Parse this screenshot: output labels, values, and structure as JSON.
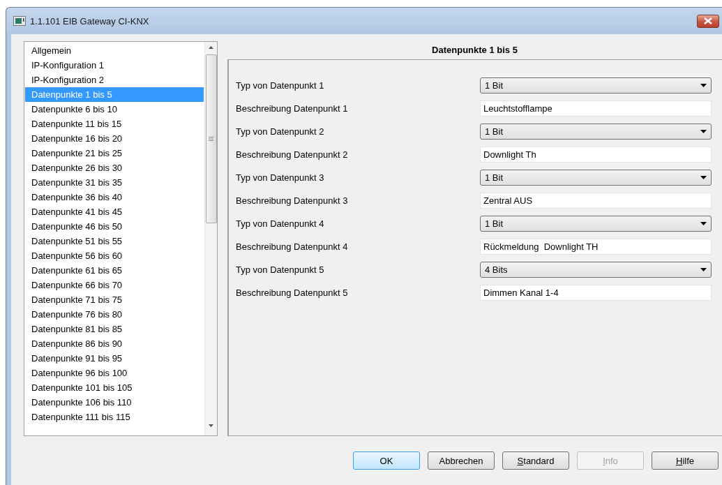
{
  "window": {
    "title": "1.1.101 EIB Gateway CI-KNX"
  },
  "sidebar": {
    "items": [
      {
        "label": "Allgemein",
        "selected": false
      },
      {
        "label": "IP-Konfiguration 1",
        "selected": false
      },
      {
        "label": "IP-Konfiguration 2",
        "selected": false
      },
      {
        "label": "Datenpunkte 1 bis 5",
        "selected": true
      },
      {
        "label": "Datenpunkte 6 bis 10",
        "selected": false
      },
      {
        "label": "Datenpunkte 11 bis 15",
        "selected": false
      },
      {
        "label": "Datenpunkte 16 bis 20",
        "selected": false
      },
      {
        "label": "Datenpunkte 21 bis 25",
        "selected": false
      },
      {
        "label": "Datenpunkte 26 bis 30",
        "selected": false
      },
      {
        "label": "Datenpunkte 31 bis 35",
        "selected": false
      },
      {
        "label": "Datenpunkte 36 bis 40",
        "selected": false
      },
      {
        "label": "Datenpunkte 41 bis 45",
        "selected": false
      },
      {
        "label": "Datenpunkte 46 bis 50",
        "selected": false
      },
      {
        "label": "Datenpunkte 51 bis 55",
        "selected": false
      },
      {
        "label": "Datenpunkte 56 bis 60",
        "selected": false
      },
      {
        "label": "Datenpunkte 61 bis 65",
        "selected": false
      },
      {
        "label": "Datenpunkte 66 bis 70",
        "selected": false
      },
      {
        "label": "Datenpunkte 71 bis 75",
        "selected": false
      },
      {
        "label": "Datenpunkte 76 bis 80",
        "selected": false
      },
      {
        "label": "Datenpunkte 81 bis 85",
        "selected": false
      },
      {
        "label": "Datenpunkte 86 bis 90",
        "selected": false
      },
      {
        "label": "Datenpunkte 91 bis 95",
        "selected": false
      },
      {
        "label": "Datenpunkte 96 bis 100",
        "selected": false
      },
      {
        "label": "Datenpunkte 101 bis 105",
        "selected": false
      },
      {
        "label": "Datenpunkte 106 bis 110",
        "selected": false
      },
      {
        "label": "Datenpunkte 111 bis 115",
        "selected": false
      }
    ]
  },
  "panel": {
    "title": "Datenpunkte 1 bis 5",
    "rows": [
      {
        "kind": "select",
        "label": "Typ von Datenpunkt 1",
        "value": "1 Bit"
      },
      {
        "kind": "text",
        "label": "Beschreibung Datenpunkt 1",
        "value": "Leuchtstofflampe"
      },
      {
        "kind": "select",
        "label": "Typ von Datenpunkt 2",
        "value": "1 Bit"
      },
      {
        "kind": "text",
        "label": "Beschreibung Datenpunkt 2",
        "value": "Downlight Th"
      },
      {
        "kind": "select",
        "label": "Typ von Datenpunkt 3",
        "value": "1 Bit"
      },
      {
        "kind": "text",
        "label": "Beschreibung Datenpunkt 3",
        "value": "Zentral AUS"
      },
      {
        "kind": "select",
        "label": "Typ von Datenpunkt 4",
        "value": "1 Bit"
      },
      {
        "kind": "text",
        "label": "Beschreibung Datenpunkt 4",
        "value": "Rückmeldung  Downlight TH"
      },
      {
        "kind": "select",
        "label": "Typ von Datenpunkt 5",
        "value": "4 Bits"
      },
      {
        "kind": "text",
        "label": "Beschreibung Datenpunkt 5",
        "value": "Dimmen Kanal 1-4"
      }
    ]
  },
  "buttons": [
    {
      "label": "OK",
      "default": true,
      "disabled": false,
      "underline_first": false
    },
    {
      "label": "Abbrechen",
      "default": false,
      "disabled": false,
      "underline_first": false
    },
    {
      "label": "Standard",
      "default": false,
      "disabled": false,
      "underline_first": true
    },
    {
      "label": "Info",
      "default": false,
      "disabled": true,
      "underline_first": true
    },
    {
      "label": "Hilfe",
      "default": false,
      "disabled": false,
      "underline_first": true
    }
  ]
}
